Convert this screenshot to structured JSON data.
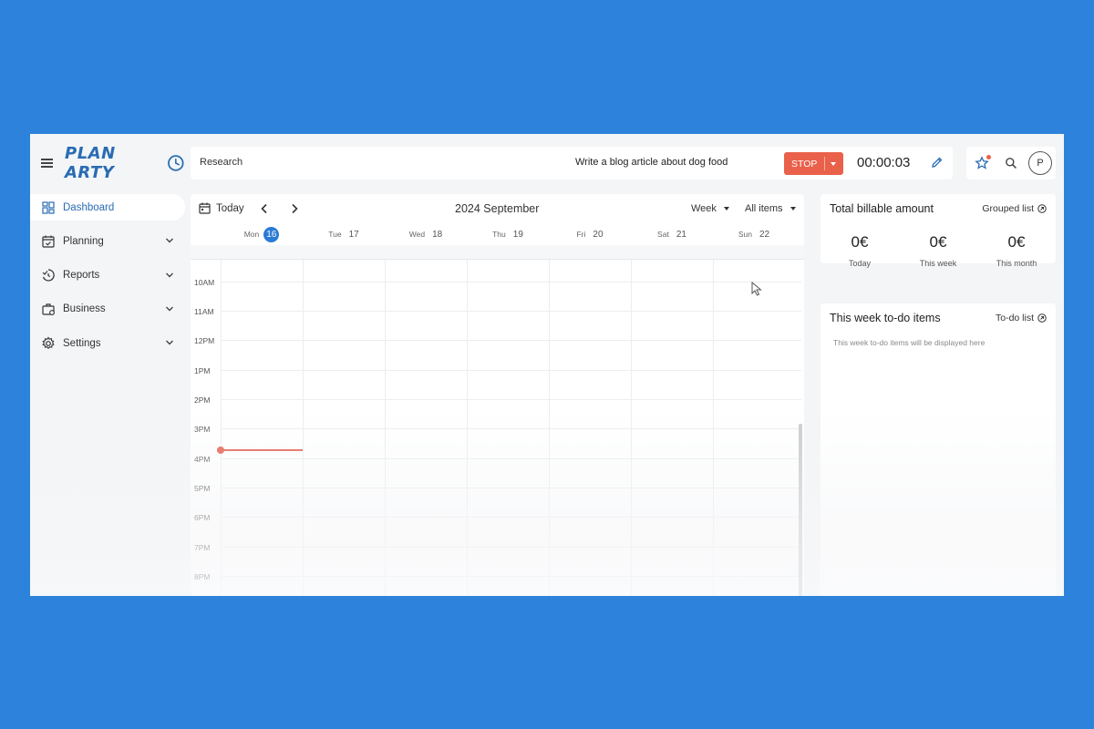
{
  "brand": {
    "logo_text": "PLAN ARTY"
  },
  "sidebar": {
    "items": [
      {
        "label": "Dashboard",
        "active": true
      },
      {
        "label": "Planning"
      },
      {
        "label": "Reports"
      },
      {
        "label": "Business"
      },
      {
        "label": "Settings"
      }
    ]
  },
  "timer_bar": {
    "project": "Research",
    "task": "Write a blog article about dog food",
    "stop_label": "STOP",
    "elapsed": "00:00:03"
  },
  "header_actions": {
    "avatar_initial": "P"
  },
  "calendar": {
    "today_label": "Today",
    "title": "2024 September",
    "view": "Week",
    "filter": "All items",
    "days": [
      {
        "name": "Mon",
        "num": "16",
        "today": true
      },
      {
        "name": "Tue",
        "num": "17"
      },
      {
        "name": "Wed",
        "num": "18"
      },
      {
        "name": "Thu",
        "num": "19"
      },
      {
        "name": "Fri",
        "num": "20"
      },
      {
        "name": "Sat",
        "num": "21"
      },
      {
        "name": "Sun",
        "num": "22"
      }
    ],
    "hours": [
      "10AM",
      "11AM",
      "12PM",
      "1PM",
      "2PM",
      "3PM",
      "4PM",
      "5PM",
      "6PM",
      "7PM",
      "8PM"
    ]
  },
  "billable": {
    "title": "Total billable amount",
    "link": "Grouped list",
    "stats": [
      {
        "value": "0€",
        "label": "Today"
      },
      {
        "value": "0€",
        "label": "This week"
      },
      {
        "value": "0€",
        "label": "This month"
      }
    ]
  },
  "todo": {
    "title": "This week to-do items",
    "link": "To-do list",
    "empty_text": "This week to-do items will be displayed here"
  },
  "colors": {
    "accent": "#2a6cb3",
    "stop": "#e9614a",
    "now_line": "#e45d4e",
    "background": "#2d83dc"
  }
}
